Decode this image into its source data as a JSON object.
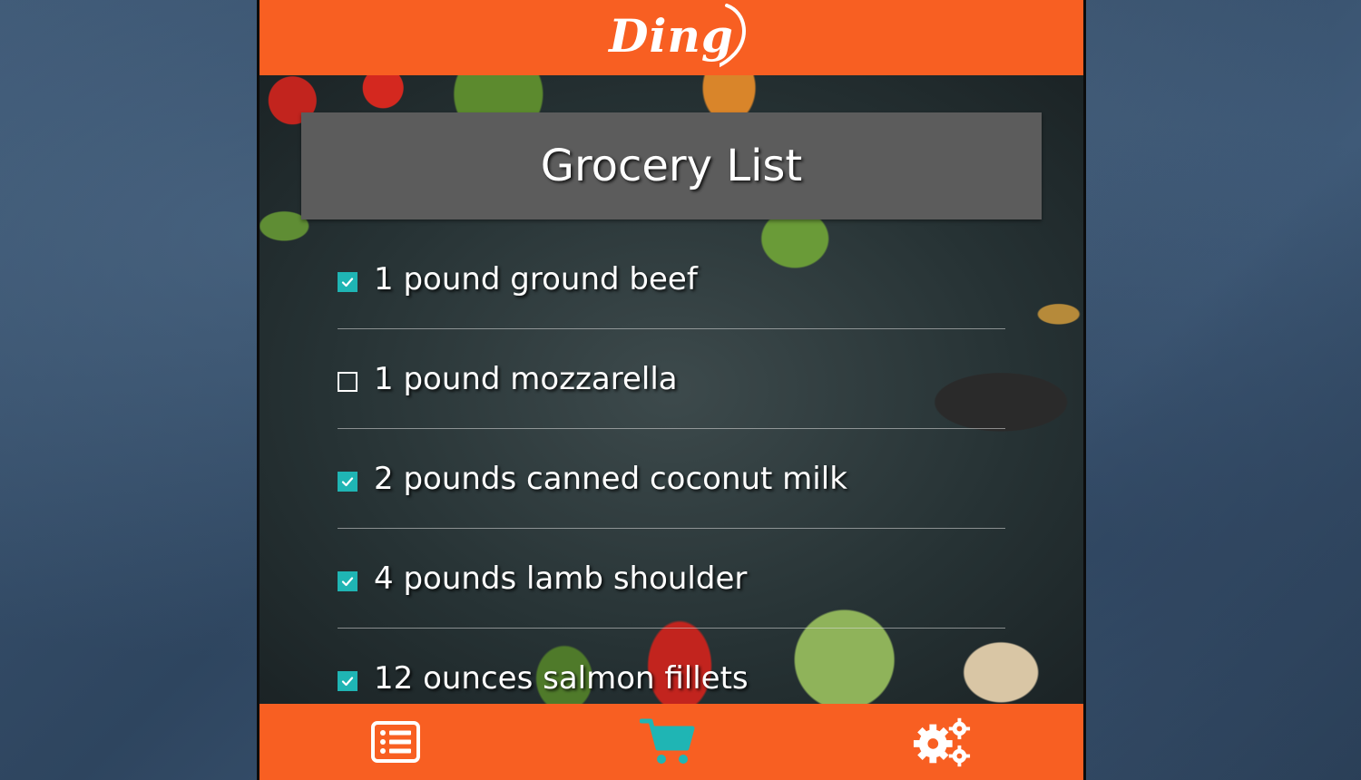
{
  "app": {
    "logo_text": "Ding"
  },
  "page": {
    "title": "Grocery List"
  },
  "items": [
    {
      "label": "1 pound ground beef",
      "checked": true
    },
    {
      "label": "1 pound mozzarella",
      "checked": false
    },
    {
      "label": "2 pounds canned coconut milk",
      "checked": true
    },
    {
      "label": "4 pounds lamb shoulder",
      "checked": true
    },
    {
      "label": "12 ounces salmon fillets",
      "checked": true
    }
  ],
  "nav": [
    {
      "icon": "list-icon",
      "active": false
    },
    {
      "icon": "cart-icon",
      "active": true
    },
    {
      "icon": "gears-icon",
      "active": false
    }
  ],
  "colors": {
    "brand_orange": "#f85f22",
    "check_teal": "#1fb5b4",
    "title_box_gray": "#5c5c5c",
    "page_background_blue": "#3c5673"
  }
}
